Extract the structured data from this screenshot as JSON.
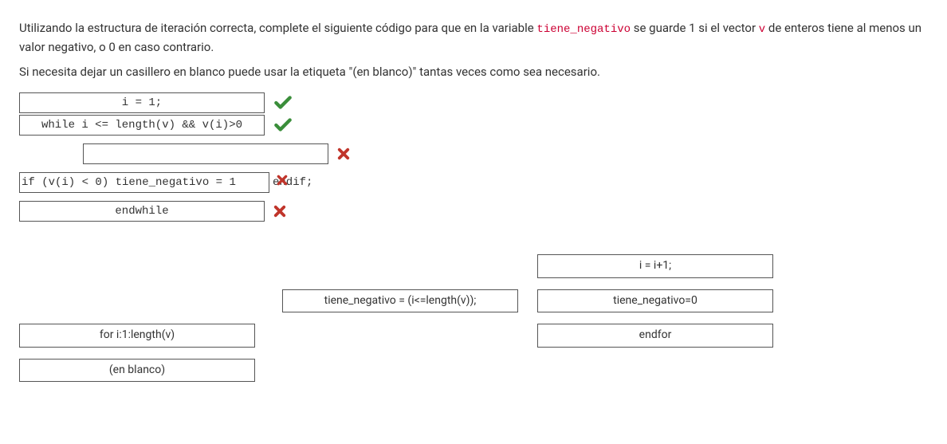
{
  "instructions": {
    "para1_pre": "Utilizando la estructura de iteración correcta, complete el siguiente código para que en la variable ",
    "para1_code1": "tiene_negativo",
    "para1_mid": " se guarde 1 si el vector ",
    "para1_code2": "v",
    "para1_post": " de enteros tiene al menos un valor negativo, o 0 en caso contrario.",
    "para2": "Si necesita dejar un casillero en blanco puede usar la etiqueta \"(en blanco)\" tantas veces como sea necesario."
  },
  "answers": {
    "row1": {
      "text": "i = 1;",
      "feedback": "correct"
    },
    "row2": {
      "text": "while i <= length(v) && v(i)>0",
      "feedback": "correct"
    },
    "row3": {
      "text": "",
      "feedback": "wrong"
    },
    "row4": {
      "text": "if (v(i) < 0) tiene_negativo = 1 endif;",
      "feedback": "wrong_overlay",
      "box_text": "if (v(i) < 0) tiene_negativo = 1",
      "after_text": "endif;"
    },
    "row5": {
      "text": "endwhile",
      "feedback": "wrong"
    }
  },
  "options": {
    "o1": "i = i+1;",
    "o2": "tiene_negativo = (i<=length(v));",
    "o3": "tiene_negativo=0",
    "o4": "for i:1:length(v)",
    "o5": "endfor",
    "o6": "(en blanco)"
  }
}
